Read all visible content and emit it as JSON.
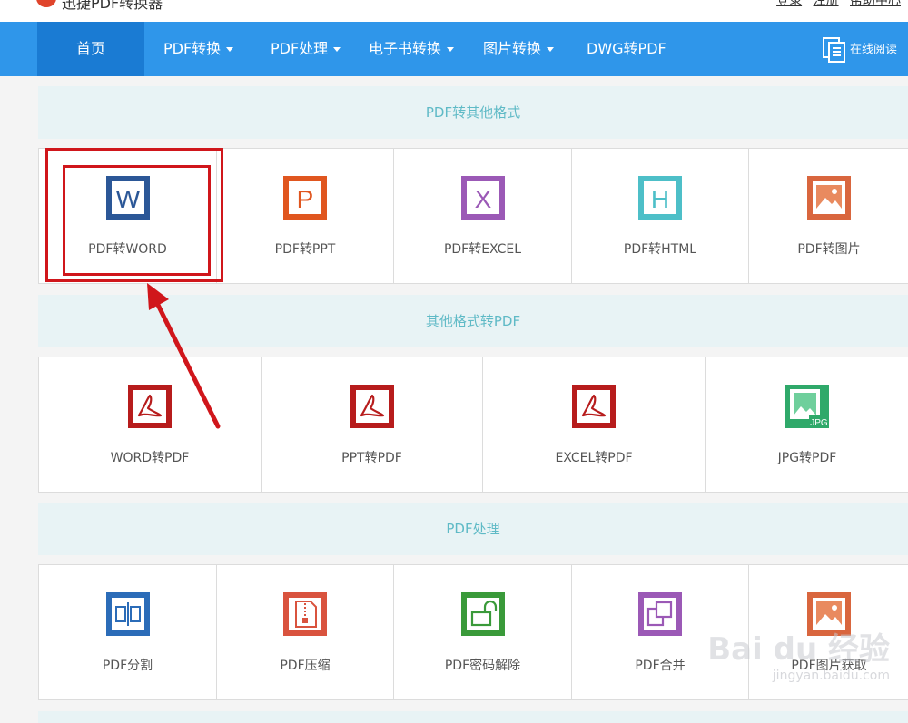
{
  "app": {
    "logo_text": "迅捷PDF转换器",
    "top_links": [
      "登录",
      "注册",
      "帮助中心"
    ]
  },
  "nav": {
    "items": [
      {
        "label": "首页",
        "active": true,
        "dropdown": false
      },
      {
        "label": "PDF转换",
        "dropdown": true
      },
      {
        "label": "PDF处理",
        "dropdown": true
      },
      {
        "label": "电子书转换",
        "dropdown": true
      },
      {
        "label": "图片转换",
        "dropdown": true
      },
      {
        "label": "DWG转PDF",
        "dropdown": false
      }
    ],
    "read_online": "在线阅读",
    "read_online_icon": "document-list-icon"
  },
  "sections": [
    {
      "title": "PDF转其他格式",
      "tools": [
        {
          "label": "PDF转WORD",
          "icon": "word-icon",
          "icon_letter": "W",
          "color": "#2b5797"
        },
        {
          "label": "PDF转PPT",
          "icon": "ppt-icon",
          "icon_letter": "P",
          "color": "#e0561f"
        },
        {
          "label": "PDF转EXCEL",
          "icon": "excel-icon",
          "icon_letter": "X",
          "color": "#9b59b6"
        },
        {
          "label": "PDF转HTML",
          "icon": "html-icon",
          "icon_letter": "H",
          "color": "#4dbfc8"
        },
        {
          "label": "PDF转图片",
          "icon": "image-icon",
          "color": "#d9663e"
        }
      ]
    },
    {
      "title": "其他格式转PDF",
      "tools": [
        {
          "label": "WORD转PDF",
          "icon": "pdf-icon",
          "color": "#b71c1c"
        },
        {
          "label": "PPT转PDF",
          "icon": "pdf-icon",
          "color": "#b71c1c"
        },
        {
          "label": "EXCEL转PDF",
          "icon": "pdf-icon",
          "color": "#b71c1c"
        },
        {
          "label": "JPG转PDF",
          "icon": "jpg-icon",
          "icon_letter": "JPG",
          "color": "#2fa96a"
        }
      ]
    },
    {
      "title": "PDF处理",
      "tools": [
        {
          "label": "PDF分割",
          "icon": "split-icon",
          "color": "#2b6cb8"
        },
        {
          "label": "PDF压缩",
          "icon": "compress-icon",
          "color": "#d9533e"
        },
        {
          "label": "PDF密码解除",
          "icon": "unlock-icon",
          "color": "#3a9a3a"
        },
        {
          "label": "PDF合并",
          "icon": "merge-icon",
          "color": "#9b59b6"
        },
        {
          "label": "PDF图片获取",
          "icon": "image-icon",
          "color": "#d9663e"
        }
      ]
    }
  ],
  "watermark": {
    "main": "Bai du 经验",
    "sub": "jingyan.baidu.com"
  }
}
